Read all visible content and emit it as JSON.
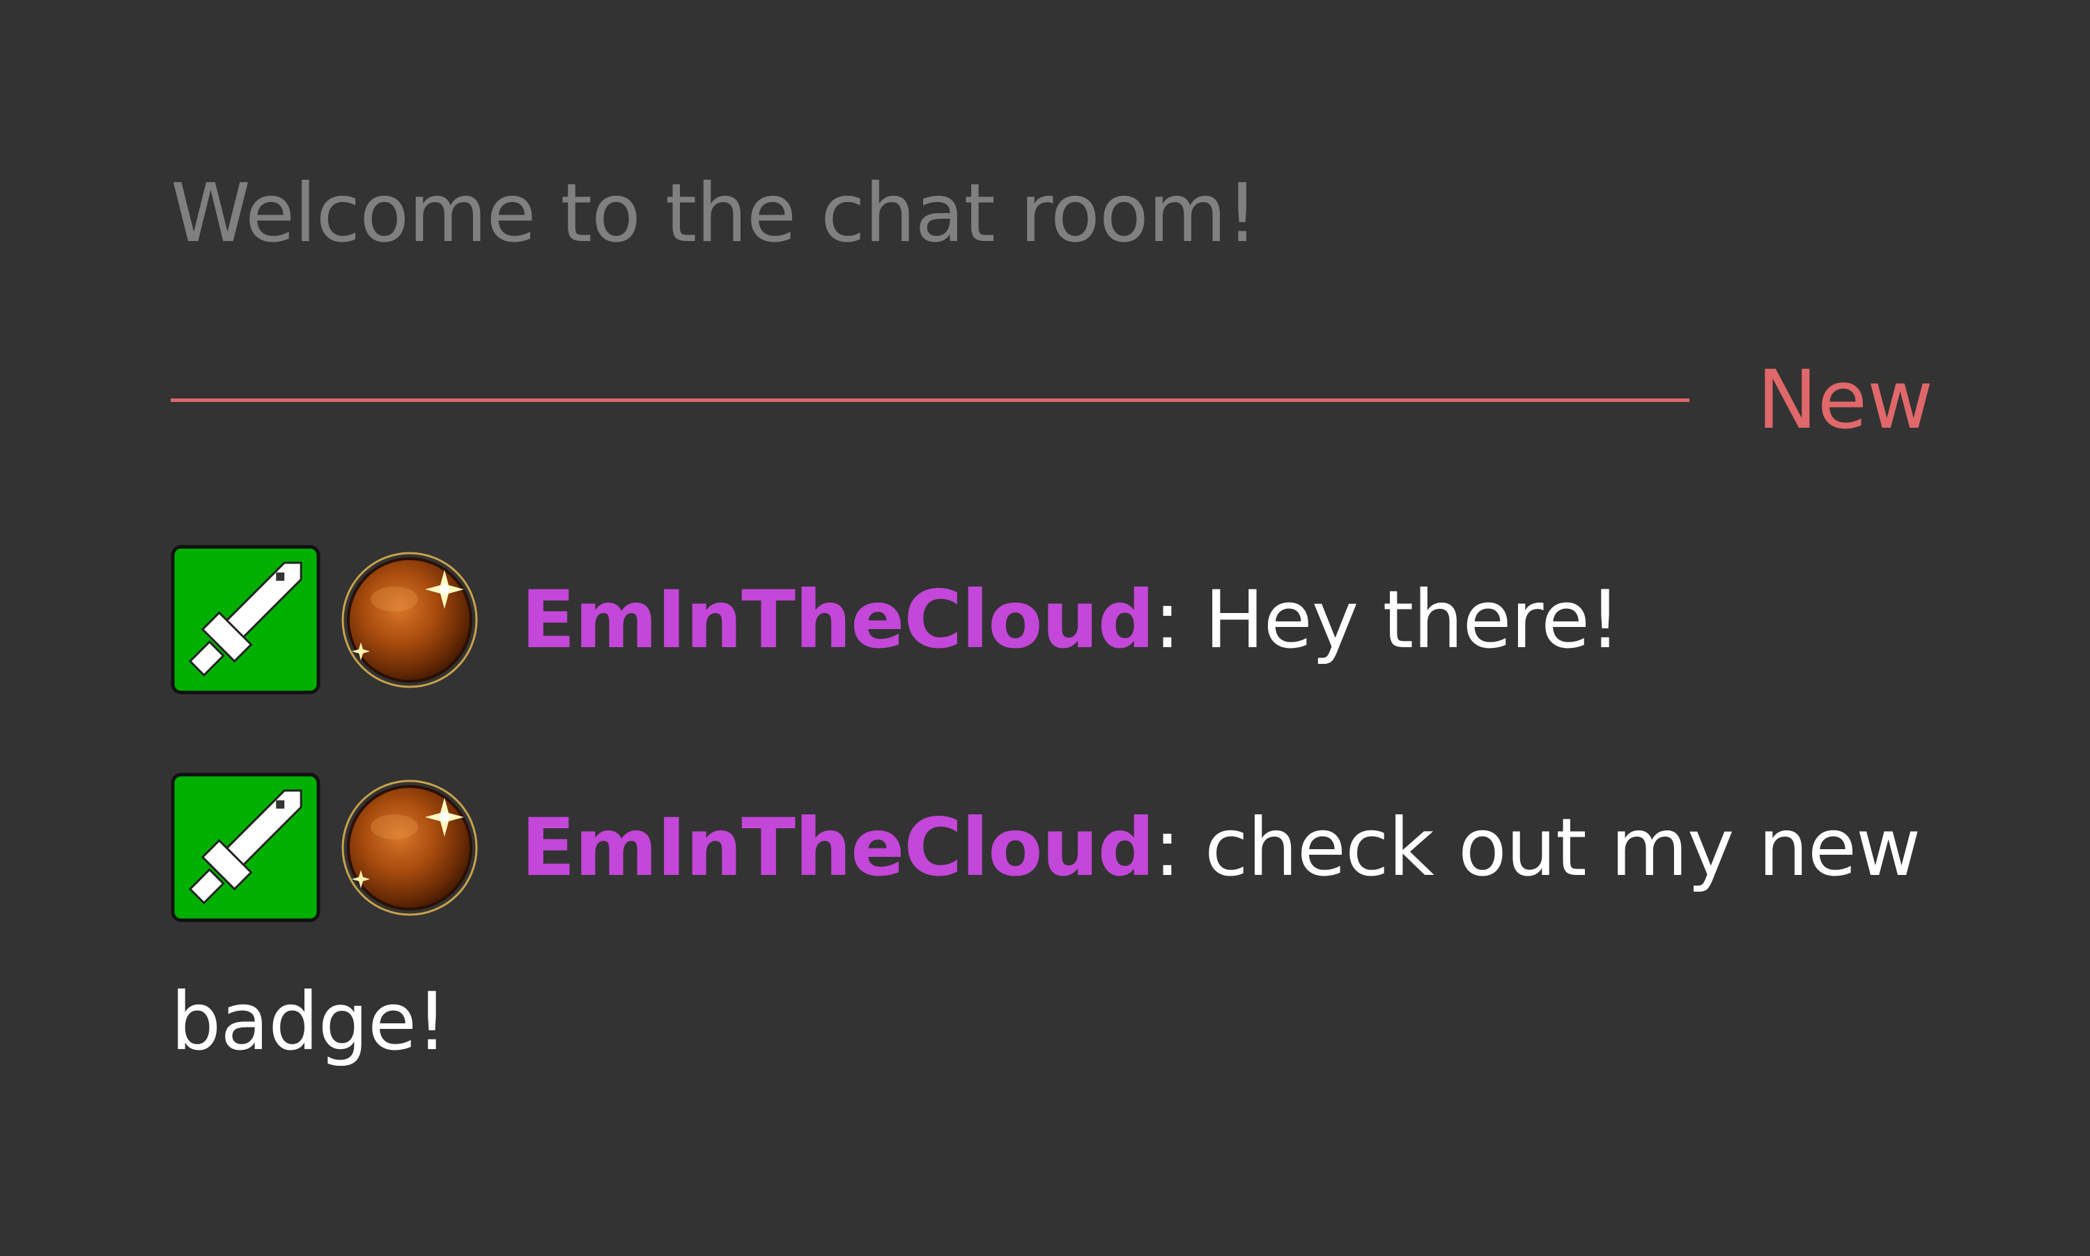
{
  "chat": {
    "welcome": "Welcome to the chat room!",
    "new_marker": "New",
    "messages": [
      {
        "username": "EmInTheCloud",
        "separator": ":",
        "text": " Hey there!",
        "badges": [
          "sword-icon",
          "orb-icon"
        ]
      },
      {
        "username": "EmInTheCloud",
        "separator": ":",
        "text": " check out my new badge!",
        "badges": [
          "sword-icon",
          "orb-icon"
        ]
      }
    ]
  },
  "colors": {
    "background": "#333333",
    "welcome_text": "#808080",
    "new_marker": "#e0686a",
    "username": "#c347d8",
    "message_text": "#ffffff",
    "badge_green": "#00b000"
  }
}
